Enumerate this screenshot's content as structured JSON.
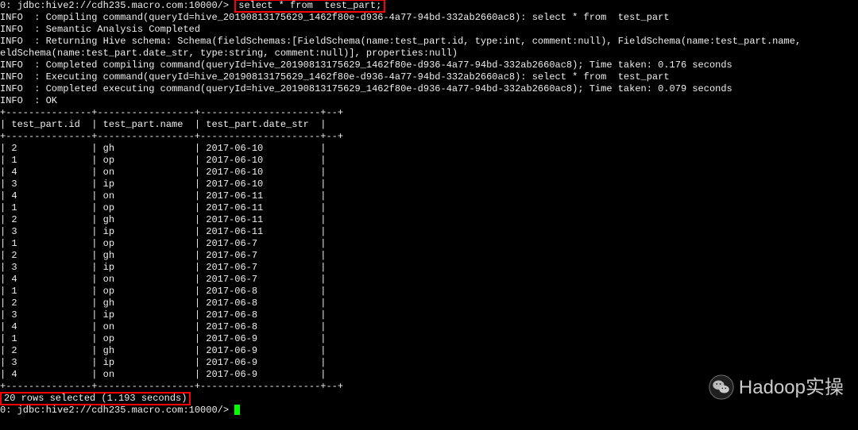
{
  "prompt": "0: jdbc:hive2://cdh235.macro.com:10000/>",
  "query": "select * from  test_part;",
  "logs": [
    "INFO  : Compiling command(queryId=hive_20190813175629_1462f80e-d936-4a77-94bd-332ab2660ac8): select * from  test_part",
    "INFO  : Semantic Analysis Completed",
    "INFO  : Returning Hive schema: Schema(fieldSchemas:[FieldSchema(name:test_part.id, type:int, comment:null), FieldSchema(name:test_part.name,",
    "eldSchema(name:test_part.date_str, type:string, comment:null)], properties:null)",
    "INFO  : Completed compiling command(queryId=hive_20190813175629_1462f80e-d936-4a77-94bd-332ab2660ac8); Time taken: 0.176 seconds",
    "INFO  : Executing command(queryId=hive_20190813175629_1462f80e-d936-4a77-94bd-332ab2660ac8): select * from  test_part",
    "INFO  : Completed executing command(queryId=hive_20190813175629_1462f80e-d936-4a77-94bd-332ab2660ac8); Time taken: 0.079 seconds",
    "INFO  : OK"
  ],
  "headers": [
    "test_part.id",
    "test_part.name",
    "test_part.date_str"
  ],
  "rows": [
    [
      "2",
      "gh",
      "2017-06-10"
    ],
    [
      "1",
      "op",
      "2017-06-10"
    ],
    [
      "4",
      "on",
      "2017-06-10"
    ],
    [
      "3",
      "ip",
      "2017-06-10"
    ],
    [
      "4",
      "on",
      "2017-06-11"
    ],
    [
      "1",
      "op",
      "2017-06-11"
    ],
    [
      "2",
      "gh",
      "2017-06-11"
    ],
    [
      "3",
      "ip",
      "2017-06-11"
    ],
    [
      "1",
      "op",
      "2017-06-7"
    ],
    [
      "2",
      "gh",
      "2017-06-7"
    ],
    [
      "3",
      "ip",
      "2017-06-7"
    ],
    [
      "4",
      "on",
      "2017-06-7"
    ],
    [
      "1",
      "op",
      "2017-06-8"
    ],
    [
      "2",
      "gh",
      "2017-06-8"
    ],
    [
      "3",
      "ip",
      "2017-06-8"
    ],
    [
      "4",
      "on",
      "2017-06-8"
    ],
    [
      "1",
      "op",
      "2017-06-9"
    ],
    [
      "2",
      "gh",
      "2017-06-9"
    ],
    [
      "3",
      "ip",
      "2017-06-9"
    ],
    [
      "4",
      "on",
      "2017-06-9"
    ]
  ],
  "summary": "20 rows selected (1.193 seconds)",
  "prompt2": "0: jdbc:hive2://cdh235.macro.com:10000/> ",
  "border": "+---------------+-----------------+---------------------+--+",
  "watermark": "Hadoop实操"
}
